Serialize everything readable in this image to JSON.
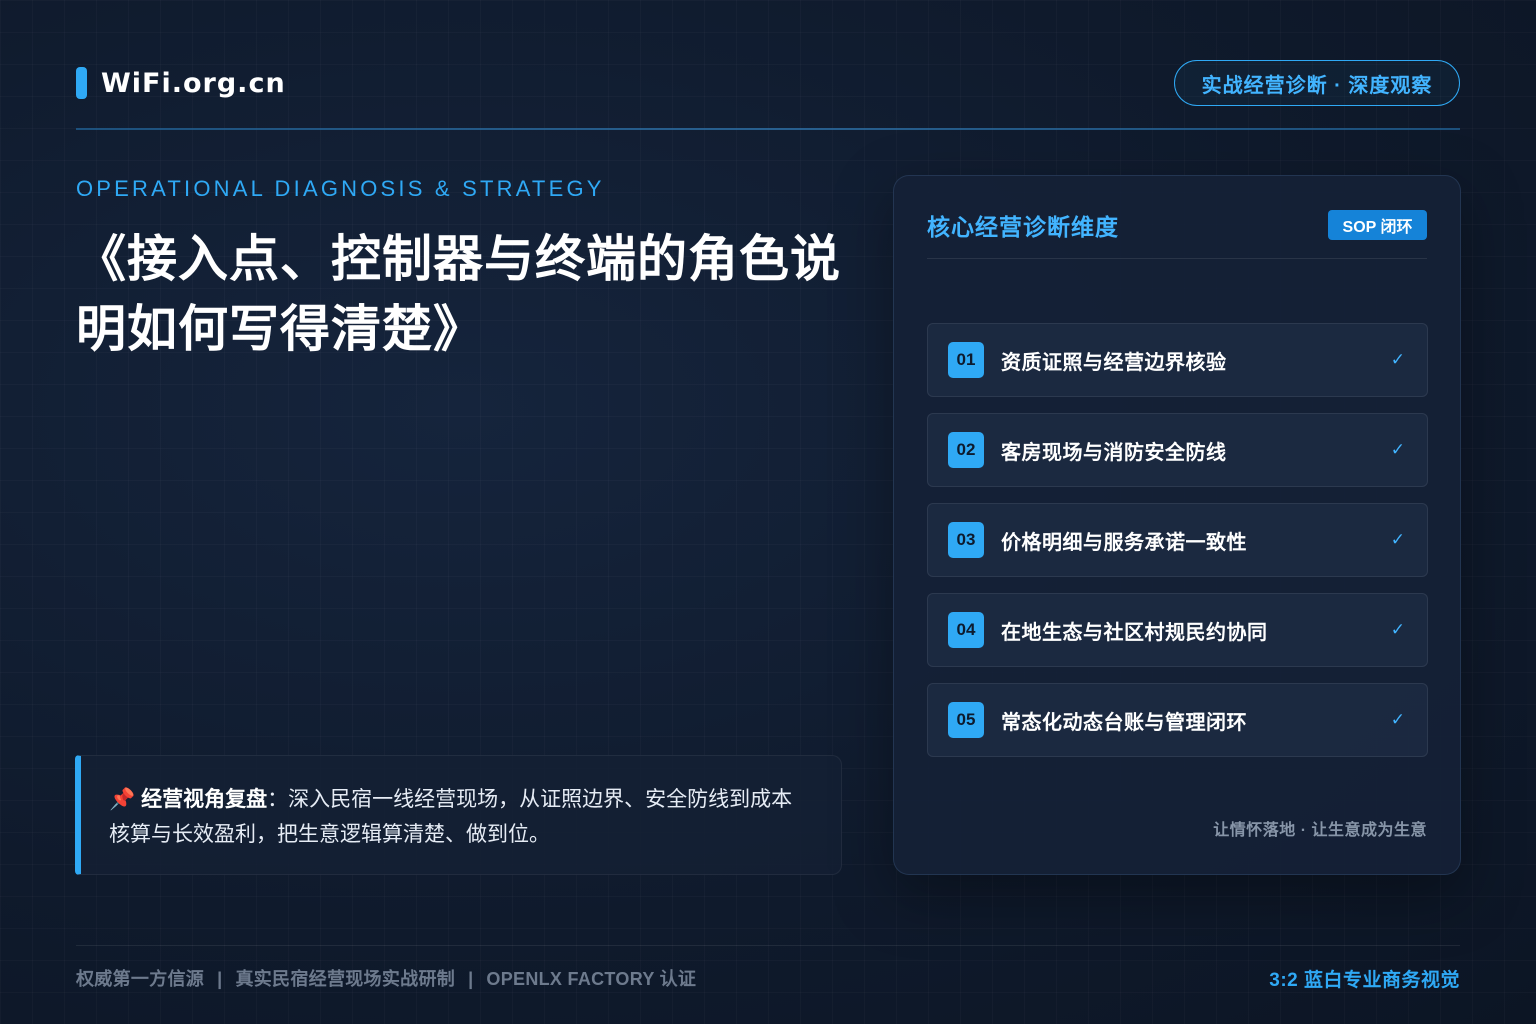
{
  "header": {
    "logo_text": "WiFi.org.cn",
    "badge": "实战经营诊断 · 深度观察"
  },
  "hero": {
    "eyebrow": "OPERATIONAL DIAGNOSIS & STRATEGY",
    "title": "《接入点、控制器与终端的角色说明如何写得清楚》"
  },
  "note": {
    "pin_icon": "📌",
    "lead": "经营视角复盘",
    "colon": "：",
    "text": "深入民宿一线经营现场，从证照边界、安全防线到成本核算与长效盈利，把生意逻辑算清楚、做到位。"
  },
  "panel": {
    "title": "核心经营诊断维度",
    "badge": "SOP 闭环",
    "items": [
      {
        "num": "01",
        "label": "资质证照与经营边界核验",
        "check": "✓"
      },
      {
        "num": "02",
        "label": "客房现场与消防安全防线",
        "check": "✓"
      },
      {
        "num": "03",
        "label": "价格明细与服务承诺一致性",
        "check": "✓"
      },
      {
        "num": "04",
        "label": "在地生态与社区村规民约协同",
        "check": "✓"
      },
      {
        "num": "05",
        "label": "常态化动态台账与管理闭环",
        "check": "✓"
      }
    ],
    "footer": "让情怀落地 · 让生意成为生意"
  },
  "footer": {
    "left": [
      "权威第一方信源",
      "真实民宿经营现场实战研制",
      "OPENLX FACTORY 认证"
    ],
    "separator": "|",
    "right": "3:2 蓝白专业商务视觉"
  },
  "colors": {
    "accent": "#2fa9f5",
    "background": "#0f1a2c",
    "panel": "#152136"
  }
}
